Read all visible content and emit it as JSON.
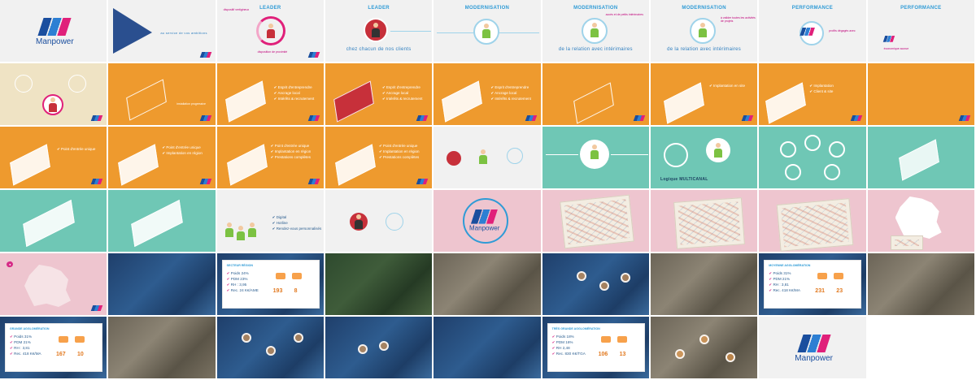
{
  "brand": {
    "name": "Manpower",
    "colors": {
      "navy": "#1a4e9e",
      "blue": "#2d7fd3",
      "pink": "#e0207a",
      "orange": "#ee9a2e",
      "teal": "#6fc7b5",
      "rosy": "#eec5cf"
    }
  },
  "row1": {
    "c2_caption": "au service de vos ambitions",
    "c3_title": "LEADER",
    "c3_ann_a": "dispositif vertigineux",
    "c3_ann_b": "disposition de proximité",
    "c4_title": "LEADER",
    "c4_caption": "chez chacun de nos clients",
    "c5_title": "MODERNISATION",
    "c6_title": "MODERNISATION",
    "c6_caption": "de la relation avec intérimaires",
    "c6_ann": "accès et de petits intérimaires",
    "c7_title": "MODERNISATION",
    "c7_caption": "de la relation avec intérimaires",
    "c7_ann": "à valider toutes les activités de projets",
    "c8_title": "PERFORMANCE",
    "c8_ann": "profits dégagés avec",
    "c9_title": "PERFORMANCE",
    "c9_ann": "économique accrue"
  },
  "row2": {
    "c2_ann": "installation progressive",
    "c3_bullets": [
      "Esprit d'entreprendre",
      "Ancrage local",
      "Intérêts & recrutement"
    ],
    "c4_bullets": [
      "Esprit d'entreprendre",
      "Ancrage local",
      "Intérêts & recrutement"
    ],
    "c5_bullets": [
      "Esprit d'entreprendre",
      "Ancrage local",
      "Intérêts & recrutement"
    ],
    "c7_bullets": [
      "Implantation en site"
    ],
    "c8_bullets": [
      "Implantation",
      "Client & site"
    ]
  },
  "row3": {
    "c1_bullets": [
      "Point d'entrée unique"
    ],
    "c2_bullets": [
      "Point d'entrée unique",
      "Implantation en région"
    ],
    "c3_bullets": [
      "Point d'entrée unique",
      "Implantation en région",
      "Prestations complètes"
    ],
    "c4_bullets": [
      "Point d'entrée unique",
      "Implantation en région",
      "Prestations complètes"
    ],
    "c6_caption": "Logique MULTICANAL"
  },
  "row4": {
    "c3_bullets": [
      "Digital",
      "Hotline",
      "Rendez-vous personnalisés"
    ],
    "c5_brand": "Manpower"
  },
  "row5": {
    "c3_card": {
      "header": "SECTEUR RÉGION",
      "items": [
        "Poids 24%",
        "PDM 23%",
        "RH : 3,95",
        "Rec. 24 K€/AME"
      ],
      "stats": [
        "193",
        "8"
      ]
    },
    "c8_card": {
      "header": "MOYENNE AGGLOMÉRATION",
      "items": [
        "Poids 31%",
        "PDM 21%",
        "RH : 3,81",
        "Rec. 418 K€/MA"
      ],
      "stats": [
        "231",
        "23"
      ]
    }
  },
  "row6": {
    "c1_card": {
      "header": "GRANDE AGGLOMÉRATION",
      "items": [
        "Poids 31%",
        "PDM 21%",
        "RH : 3,81",
        "Rec. 418 K€/MA"
      ],
      "stats": [
        "167",
        "10"
      ]
    },
    "c6_card": {
      "header": "TRÈS GRANDE AGGLOMÉRATION",
      "items": [
        "Poids 18%",
        "PDM 16%",
        "RH 2,48",
        "Rec. 830 K€/TGA"
      ],
      "stats": [
        "106",
        "13"
      ]
    },
    "c8_brand": "Manpower"
  }
}
